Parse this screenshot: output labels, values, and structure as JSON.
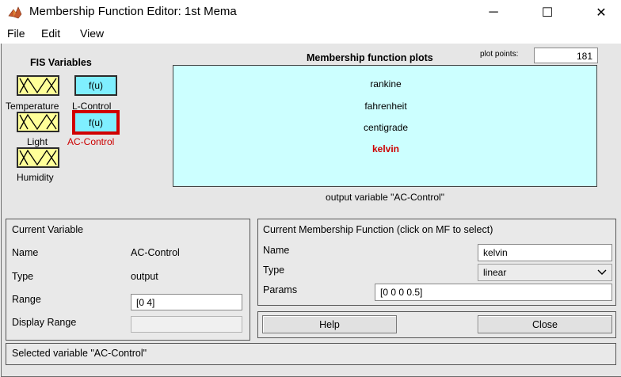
{
  "window": {
    "title": "Membership Function Editor: 1st Mema",
    "minimize_glyph": "─",
    "maximize_glyph": "☐",
    "close_glyph": "✕"
  },
  "menu": [
    "File",
    "Edit",
    "View"
  ],
  "fis": {
    "heading": "FIS Variables",
    "inputs": [
      "Temperature",
      "Light",
      "Humidity"
    ],
    "outputs": [
      {
        "label": "L-Control",
        "box_text": "f(u)"
      },
      {
        "label": "AC-Control",
        "box_text": "f(u)"
      }
    ],
    "selected": "AC-Control"
  },
  "plot": {
    "title": "Membership function plots",
    "points_label": "plot points:",
    "points_value": "181",
    "mf_names": [
      "rankine",
      "fahrenheit",
      "centigrade",
      "kelvin"
    ],
    "selected_mf": "kelvin",
    "caption": "output variable \"AC-Control\""
  },
  "current_variable": {
    "title": "Current Variable",
    "name_label": "Name",
    "name_value": "AC-Control",
    "type_label": "Type",
    "type_value": "output",
    "range_label": "Range",
    "range_value": "[0 4]",
    "display_range_label": "Display Range",
    "display_range_value": ""
  },
  "current_mf": {
    "title": "Current Membership Function (click on MF to select)",
    "name_label": "Name",
    "name_value": "kelvin",
    "type_label": "Type",
    "type_value": "linear",
    "params_label": "Params",
    "params_value": "[0 0 0 0.5]"
  },
  "buttons": {
    "help": "Help",
    "close": "Close"
  },
  "status": "Selected variable \"AC-Control\"",
  "colors": {
    "input_box": "#ffff99",
    "output_box": "#7fefff",
    "selected_border": "#d00000",
    "plot_bg": "#ccffff",
    "selected_mf_text": "#cc0000"
  }
}
